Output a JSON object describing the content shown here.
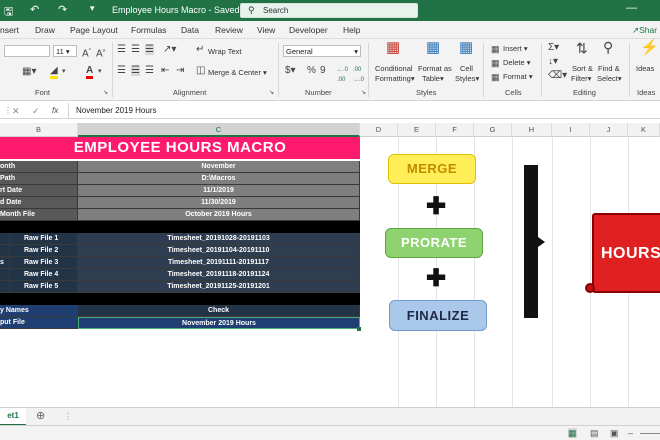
{
  "titlebar": {
    "doc_title": "Employee Hours Macro  -  Saved",
    "search_placeholder": "Search"
  },
  "menu": [
    "nsert",
    "Draw",
    "Page Layout",
    "Formulas",
    "Data",
    "Review",
    "View",
    "Developer",
    "Help"
  ],
  "share_label": "Shar",
  "ribbon": {
    "font_name": "",
    "font_size": "11",
    "wrap_text": "Wrap Text",
    "merge_center": "Merge & Center",
    "number_format": "General",
    "conditional": "Conditional",
    "formatting": "Formatting",
    "format_as": "Format as",
    "table": "Table",
    "cell": "Cell",
    "styles_btn": "Styles",
    "insert": "Insert",
    "delete": "Delete",
    "format": "Format",
    "sort_filter_1": "Sort &",
    "sort_filter_2": "Filter",
    "find_select_1": "Find &",
    "find_select_2": "Select",
    "ideas": "Ideas",
    "groups": {
      "font": "Font",
      "alignment": "Alignment",
      "number": "Number",
      "styles": "Styles",
      "cells": "Cells",
      "editing": "Editing",
      "ideas": "Ideas"
    }
  },
  "formula_bar": {
    "content": "November 2019 Hours"
  },
  "columns": [
    "B",
    "C",
    "D",
    "E",
    "F",
    "G",
    "H",
    "I",
    "J",
    "K"
  ],
  "sheet": {
    "header": "EMPLOYEE HOURS MACRO",
    "rows": [
      {
        "label": "onth",
        "value": "November"
      },
      {
        "label": "Path",
        "value": "D:\\Macros"
      },
      {
        "label": "rt Date",
        "value": "11/1/2019"
      },
      {
        "label": "d Date",
        "value": "11/30/2019"
      },
      {
        "label": " Month File",
        "value": "October 2019 Hours"
      }
    ],
    "raw_files": [
      {
        "prefix": "",
        "label": "Raw File 1",
        "value": "Timesheet_20191028-20191103"
      },
      {
        "prefix": "",
        "label": "Raw File 2",
        "value": "Timesheet_20191104-20191110"
      },
      {
        "prefix": "s",
        "label": "Raw File 3",
        "value": "Timesheet_20191111-20191117"
      },
      {
        "prefix": "",
        "label": "Raw File 4",
        "value": "Timesheet_20191118-20191124"
      },
      {
        "prefix": "",
        "label": "Raw File 5",
        "value": "Timesheet_20191125-20191201"
      }
    ],
    "names_label": "y Names",
    "names_value": "Check",
    "output_label": "put File",
    "output_value": "November 2019 Hours"
  },
  "buttons": {
    "merge": "MERGE",
    "prorate": "PRORATE",
    "finalize": "FINALIZE",
    "hours": "HOURS"
  },
  "sheet_tab": "et1",
  "colors": {
    "excel_green": "#217346",
    "header_pink": "#ff1a6e",
    "dark_gray": "#595959",
    "navy": "#243447",
    "blue": "#1f3f73"
  }
}
